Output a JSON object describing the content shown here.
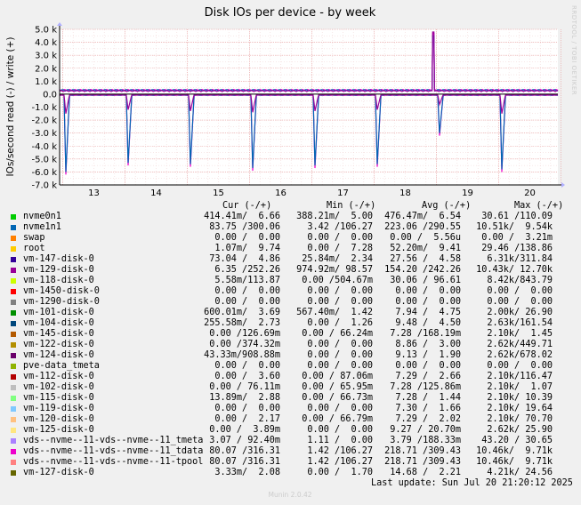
{
  "title": "Disk IOs per device - by week",
  "watermark": "RRDTOOL / TOBI OETIKER",
  "generator": "Munin 2.0.42",
  "last_update": "Last update: Sun Jul 20 21:20:12 2025",
  "legend_headers": {
    "cur": "Cur (-/+)",
    "min": "Min (-/+)",
    "avg": "Avg (-/+)",
    "max": "Max (-/+)"
  },
  "legend": [
    {
      "name": "nvme0n1",
      "color": "#00CC00",
      "cur": "414.41m/  6.66",
      "min": "388.21m/  5.00",
      "avg": "476.47m/  6.54",
      "max": "30.61 /110.09"
    },
    {
      "name": "nvme1n1",
      "color": "#0066B3",
      "cur": "83.75 /300.06",
      "min": "3.42 /106.27",
      "avg": "223.06 /290.55",
      "max": "10.51k/  9.54k"
    },
    {
      "name": "swap",
      "color": "#FF8000",
      "cur": "0.00 /  0.00",
      "min": "0.00 /  0.00",
      "avg": "0.00 /  5.56u",
      "max": "0.00 /  3.21m"
    },
    {
      "name": "root",
      "color": "#FFCC00",
      "cur": "1.07m/  9.74",
      "min": "0.00 /  7.28",
      "avg": "52.20m/  9.41",
      "max": "29.46 /138.86"
    },
    {
      "name": "vm-147-disk-0",
      "color": "#330099",
      "cur": "73.04 /  4.86",
      "min": "25.84m/  2.34",
      "avg": "27.56 /  4.58",
      "max": "6.31k/311.84"
    },
    {
      "name": "vm-129-disk-0",
      "color": "#990099",
      "cur": "6.35 /252.26",
      "min": "974.92m/ 98.57",
      "avg": "154.20 /242.26",
      "max": "10.43k/ 12.70k"
    },
    {
      "name": "vm-118-disk-0",
      "color": "#CCFF00",
      "cur": "5.58m/113.87",
      "min": "0.00 /504.67m",
      "avg": "30.06 / 96.61",
      "max": "8.42k/843.79"
    },
    {
      "name": "vm-1450-disk-0",
      "color": "#FF0000",
      "cur": "0.00 /  0.00",
      "min": "0.00 /  0.00",
      "avg": "0.00 /  0.00",
      "max": "0.00 /  0.00"
    },
    {
      "name": "vm-1290-disk-0",
      "color": "#808080",
      "cur": "0.00 /  0.00",
      "min": "0.00 /  0.00",
      "avg": "0.00 /  0.00",
      "max": "0.00 /  0.00"
    },
    {
      "name": "vm-101-disk-0",
      "color": "#008F00",
      "cur": "600.01m/  3.69",
      "min": "567.40m/  1.42",
      "avg": "7.94 /  4.75",
      "max": "2.00k/ 26.90"
    },
    {
      "name": "vm-104-disk-0",
      "color": "#00487D",
      "cur": "255.58m/  2.73",
      "min": "0.00 /  1.26",
      "avg": "9.48 /  4.50",
      "max": "2.63k/161.54"
    },
    {
      "name": "vm-145-disk-0",
      "color": "#B35A00",
      "cur": "0.00 /126.69m",
      "min": "0.00 / 66.24m",
      "avg": "7.28 /168.19m",
      "max": "2.10k/  1.45"
    },
    {
      "name": "vm-122-disk-0",
      "color": "#B38F00",
      "cur": "0.00 /374.32m",
      "min": "0.00 /  0.00",
      "avg": "8.86 /  3.00",
      "max": "2.62k/449.71"
    },
    {
      "name": "vm-124-disk-0",
      "color": "#6B006B",
      "cur": "43.33m/908.88m",
      "min": "0.00 /  0.00",
      "avg": "9.13 /  1.90",
      "max": "2.62k/678.02"
    },
    {
      "name": "pve-data_tmeta",
      "color": "#8FB300",
      "cur": "0.00 /  0.00",
      "min": "0.00 /  0.00",
      "avg": "0.00 /  0.00",
      "max": "0.00 /  0.00"
    },
    {
      "name": "vm-112-disk-0",
      "color": "#B30000",
      "cur": "0.00 /  3.60",
      "min": "0.00 / 87.06m",
      "avg": "7.29 /  2.66",
      "max": "2.10k/116.47"
    },
    {
      "name": "vm-102-disk-0",
      "color": "#BEBEBE",
      "cur": "0.00 / 76.11m",
      "min": "0.00 / 65.95m",
      "avg": "7.28 /125.86m",
      "max": "2.10k/  1.07"
    },
    {
      "name": "vm-115-disk-0",
      "color": "#80FF80",
      "cur": "13.89m/  2.88",
      "min": "0.00 / 66.73m",
      "avg": "7.28 /  1.44",
      "max": "2.10k/ 10.39"
    },
    {
      "name": "vm-119-disk-0",
      "color": "#80C9FF",
      "cur": "0.00 /  0.00",
      "min": "0.00 /  0.00",
      "avg": "7.30 /  1.66",
      "max": "2.10k/ 19.64"
    },
    {
      "name": "vm-120-disk-0",
      "color": "#FFC080",
      "cur": "0.00 /  2.17",
      "min": "0.00 / 66.79m",
      "avg": "7.29 /  2.02",
      "max": "2.10k/ 70.70"
    },
    {
      "name": "vm-125-disk-0",
      "color": "#FFE680",
      "cur": "0.00 /  3.89m",
      "min": "0.00 /  0.00",
      "avg": "9.27 / 20.70m",
      "max": "2.62k/ 25.90"
    },
    {
      "name": "vds--nvme--11-vds--nvme--11_tmeta",
      "color": "#AA80FF",
      "cur": "3.07 / 92.40m",
      "min": "1.11 /  0.00",
      "avg": "3.79 /188.33m",
      "max": "43.20 / 30.65"
    },
    {
      "name": "vds--nvme--11-vds--nvme--11_tdata",
      "color": "#EE00CC",
      "cur": "80.07 /316.31",
      "min": "1.42 /106.27",
      "avg": "218.71 /309.43",
      "max": "10.46k/  9.71k"
    },
    {
      "name": "vds--nvme--11-vds--nvme--11-tpool",
      "color": "#FF8080",
      "cur": "80.07 /316.31",
      "min": "1.42 /106.27",
      "avg": "218.71 /309.43",
      "max": "10.46k/  9.71k"
    },
    {
      "name": "vm-127-disk-0",
      "color": "#666600",
      "cur": "3.33m/  2.08",
      "min": "0.00 /  1.70",
      "avg": "14.68 /  2.21",
      "max": "4.21k/ 24.56"
    }
  ],
  "chart_data": {
    "type": "area",
    "title": "Disk IOs per device - by week",
    "ylabel": "IOs/second read (-) / write (+)",
    "ylim": [
      -7000,
      5000
    ],
    "yticks": [
      5000,
      4000,
      3000,
      2000,
      1000,
      0,
      -1000,
      -2000,
      -3000,
      -4000,
      -5000,
      -6000,
      -7000
    ],
    "ytick_labels": [
      "5.0 k",
      "4.0 k",
      "3.0 k",
      "2.0 k",
      "1.0 k",
      "0.0",
      "-1.0 k",
      "-2.0 k",
      "-3.0 k",
      "-4.0 k",
      "-5.0 k",
      "-6.0 k",
      "-7.0 k"
    ],
    "xlim": [
      12.45,
      20.45
    ],
    "xticks": [
      13,
      14,
      15,
      16,
      17,
      18,
      19,
      20
    ],
    "xtick_labels": [
      "13",
      "14",
      "15",
      "16",
      "17",
      "18",
      "19",
      "20"
    ],
    "grid": true,
    "series": [
      {
        "name": "vds--nvme--11-vds--nvme--11_tdata",
        "color": "#EE00CC",
        "write_baseline": 300,
        "read_spikes": [
          [
            12.55,
            -6200
          ],
          [
            13.55,
            -5500
          ],
          [
            14.55,
            -5600
          ],
          [
            15.55,
            -5900
          ],
          [
            16.55,
            -5700
          ],
          [
            17.55,
            -5600
          ],
          [
            18.55,
            -3200
          ],
          [
            19.55,
            -6000
          ]
        ],
        "write_spikes": [
          [
            18.45,
            4700
          ]
        ]
      },
      {
        "name": "nvme1n1",
        "color": "#0066B3",
        "write_baseline": 290,
        "read_spikes": [
          [
            12.55,
            -6000
          ],
          [
            13.55,
            -5300
          ],
          [
            14.55,
            -5400
          ],
          [
            15.55,
            -5700
          ],
          [
            16.55,
            -5500
          ],
          [
            17.55,
            -5400
          ],
          [
            18.55,
            -3000
          ],
          [
            19.55,
            -5800
          ]
        ],
        "write_spikes": [
          [
            18.45,
            4500
          ]
        ]
      },
      {
        "name": "vm-129-disk-0",
        "color": "#990099",
        "write_baseline": 240,
        "read_spikes": [
          [
            12.55,
            -1500
          ],
          [
            13.55,
            -1200
          ],
          [
            14.55,
            -1300
          ],
          [
            15.55,
            -1400
          ],
          [
            16.55,
            -1300
          ],
          [
            17.55,
            -1200
          ],
          [
            18.55,
            -800
          ],
          [
            19.55,
            -1500
          ]
        ],
        "write_spikes": [
          [
            18.45,
            4800
          ]
        ]
      }
    ]
  }
}
